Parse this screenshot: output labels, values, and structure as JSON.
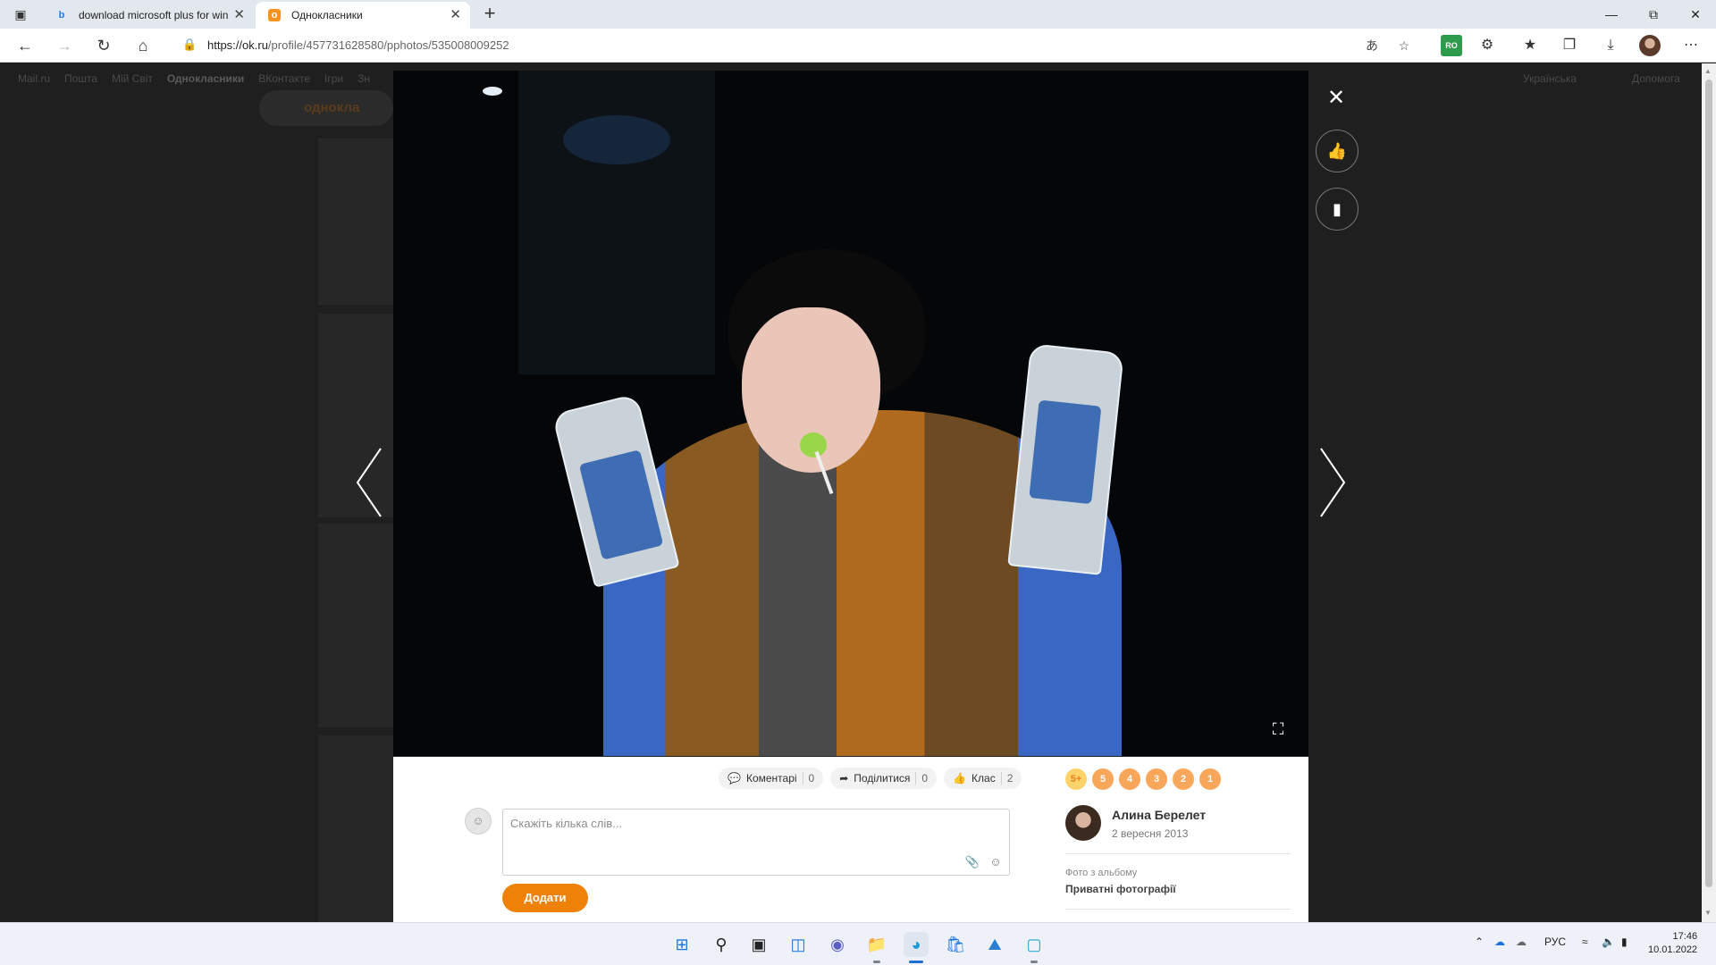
{
  "browser": {
    "tabs": [
      {
        "title": "download microsoft plus for win",
        "favicon": "bing-icon",
        "active": false
      },
      {
        "title": "Однокласники",
        "favicon": "ok-icon",
        "active": true
      }
    ],
    "url_host": "https://ok.ru",
    "url_path": "/profile/457731628580/pphotos/535008009252"
  },
  "extensions": {
    "ro_badge": "RO"
  },
  "site_nav": {
    "links": [
      "Mail.ru",
      "Пошта",
      "Мій Світ",
      "Однокласники",
      "ВКонтакте",
      "Ігри",
      "Зн"
    ],
    "language": "Українська",
    "help": "Допомога",
    "logo_text": "однокла"
  },
  "photo_actions": {
    "comments": {
      "label": "Коментарі",
      "count": "0"
    },
    "share": {
      "label": "Поділитися",
      "count": "0"
    },
    "like": {
      "label": "Клас",
      "count": "2"
    }
  },
  "ratings": [
    "5+",
    "5",
    "4",
    "3",
    "2",
    "1"
  ],
  "comment": {
    "placeholder": "Скажіть кілька слів...",
    "submit_label": "Додати"
  },
  "author": {
    "name": "Алина Берелет",
    "date": "2 вересня 2013"
  },
  "album": {
    "caption": "Фото з альбому",
    "name": "Приватні фотографії"
  },
  "system": {
    "language": "РУС",
    "time": "17:46",
    "date": "10.01.2022"
  },
  "colors": {
    "accent": "#ee8208",
    "rating": "#f7a65a",
    "overlay": "#1d1d1d"
  }
}
